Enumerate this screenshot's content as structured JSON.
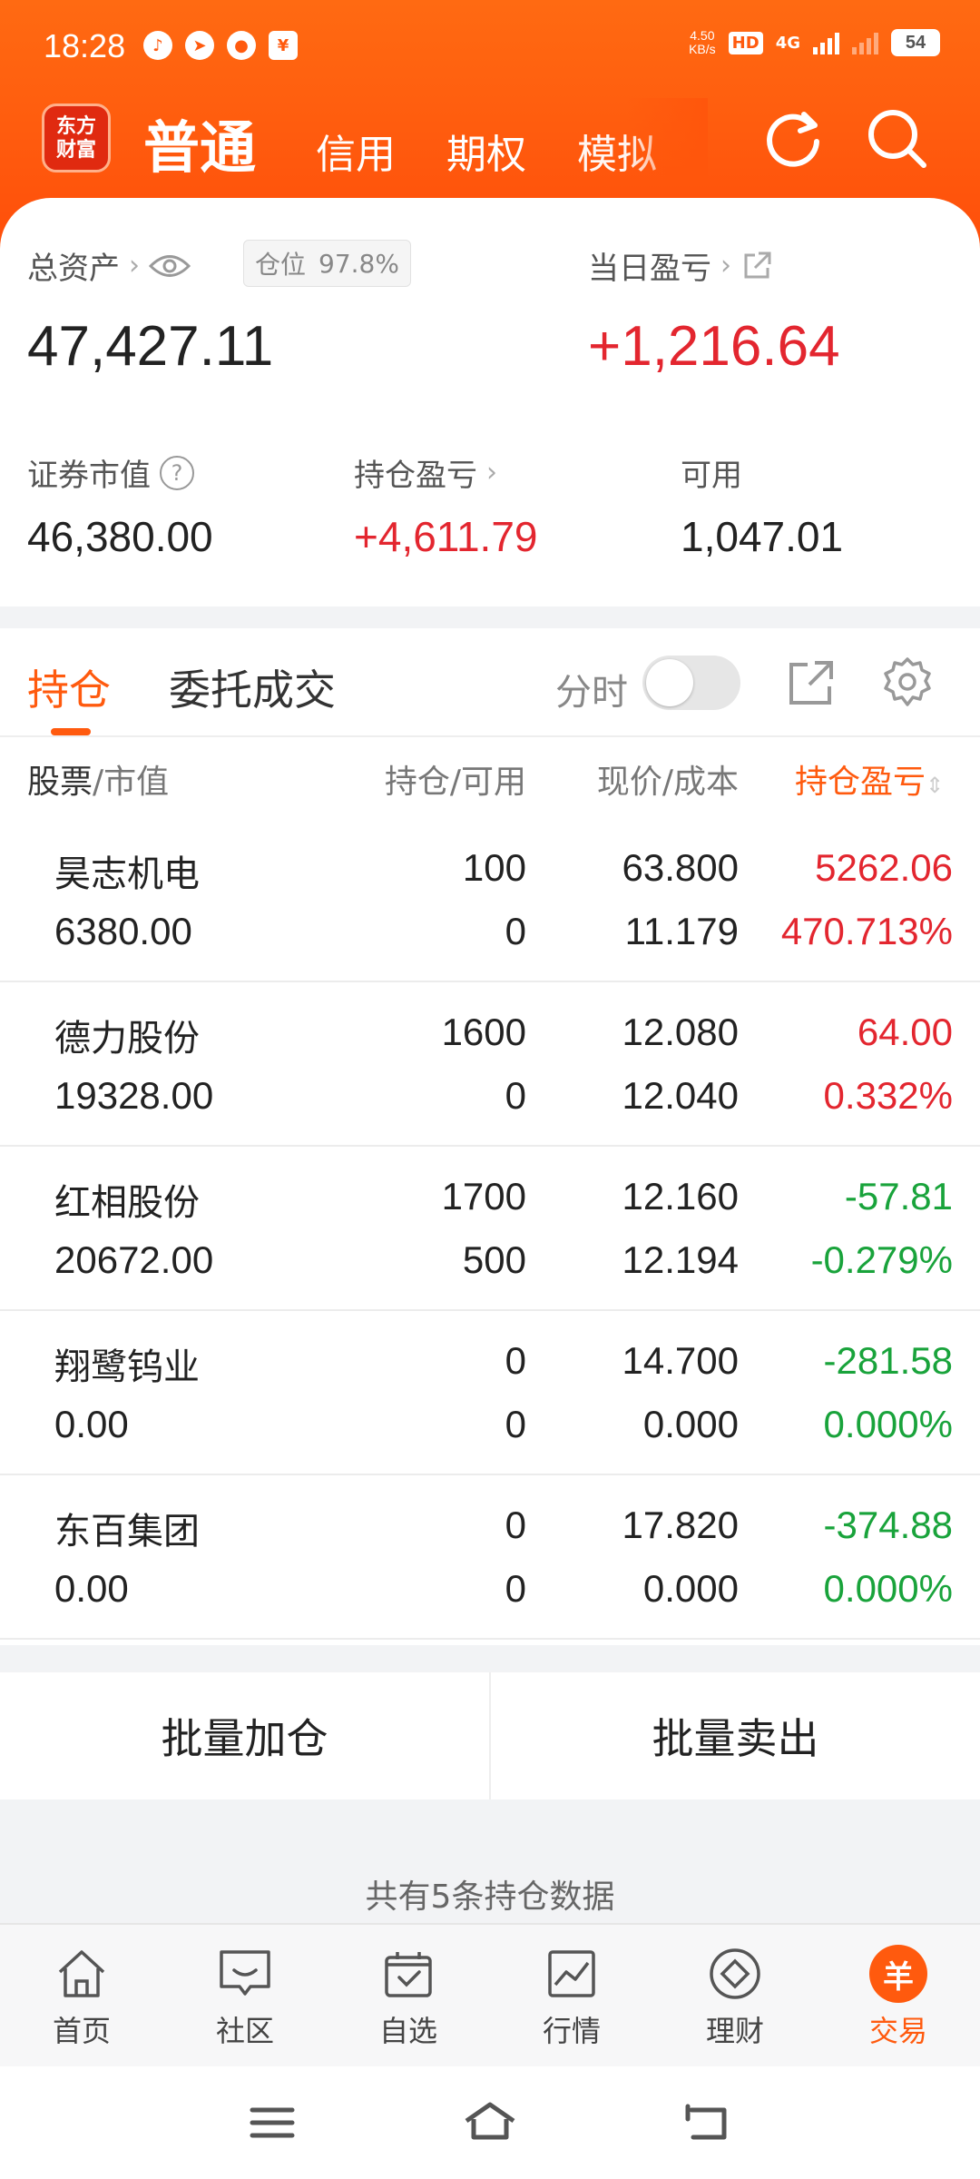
{
  "status": {
    "time": "18:28",
    "net_speed": "4.50",
    "net_unit": "KB/s",
    "hd_label": "HD",
    "network": "4G",
    "battery": "54"
  },
  "header": {
    "logo_line1": "东方",
    "logo_line2": "财富",
    "tabs": [
      "普通",
      "信用",
      "期权",
      "模拟"
    ],
    "active_tab": "普通",
    "brand_color": "#ff5a0e"
  },
  "summary": {
    "total_assets_label": "总资产",
    "position_label": "仓位",
    "position_value": "97.8%",
    "total_assets_value": "47,427.11",
    "daily_pnl_label": "当日盈亏",
    "daily_pnl_value": "+1,216.64",
    "market_value_label": "证券市值",
    "market_value": "46,380.00",
    "holding_pnl_label": "持仓盈亏",
    "holding_pnl_value": "+4,611.79",
    "available_label": "可用",
    "available_value": "1,047.01"
  },
  "holdings_tabs": {
    "active": "持仓",
    "other": "委托成交",
    "toggle_label": "分时",
    "toggle_on": false
  },
  "table": {
    "headers": {
      "stock_a": "股票",
      "stock_b": "/市值",
      "position": "持仓/可用",
      "price": "现价/成本",
      "pnl": "持仓盈亏"
    },
    "rows": [
      {
        "name": "昊志机电",
        "market_value": "6380.00",
        "position": "100",
        "available": "0",
        "price": "63.800",
        "cost": "11.179",
        "pnl": "5262.06",
        "pnl_pct": "470.713%",
        "trend": "up"
      },
      {
        "name": "德力股份",
        "market_value": "19328.00",
        "position": "1600",
        "available": "0",
        "price": "12.080",
        "cost": "12.040",
        "pnl": "64.00",
        "pnl_pct": "0.332%",
        "trend": "up"
      },
      {
        "name": "红相股份",
        "market_value": "20672.00",
        "position": "1700",
        "available": "500",
        "price": "12.160",
        "cost": "12.194",
        "pnl": "-57.81",
        "pnl_pct": "-0.279%",
        "trend": "down"
      },
      {
        "name": "翔鹭钨业",
        "market_value": "0.00",
        "position": "0",
        "available": "0",
        "price": "14.700",
        "cost": "0.000",
        "pnl": "-281.58",
        "pnl_pct": "0.000%",
        "trend": "down"
      },
      {
        "name": "东百集团",
        "market_value": "0.00",
        "position": "0",
        "available": "0",
        "price": "17.820",
        "cost": "0.000",
        "pnl": "-374.88",
        "pnl_pct": "0.000%",
        "trend": "down"
      }
    ]
  },
  "batch": {
    "add_label": "批量加仓",
    "sell_label": "批量卖出"
  },
  "footer_summary": "共有5条持仓数据",
  "bottom_nav": {
    "items": [
      {
        "label": "首页",
        "icon": "home-icon"
      },
      {
        "label": "社区",
        "icon": "chat-icon"
      },
      {
        "label": "自选",
        "icon": "watchlist-icon"
      },
      {
        "label": "行情",
        "icon": "chart-icon"
      },
      {
        "label": "理财",
        "icon": "diamond-icon"
      },
      {
        "label": "交易",
        "icon": "yuan-icon"
      }
    ],
    "active": "交易",
    "trade_glyph": "羊"
  },
  "colors": {
    "up": "#e3262f",
    "down": "#19a33b",
    "accent": "#ff5a0e"
  }
}
